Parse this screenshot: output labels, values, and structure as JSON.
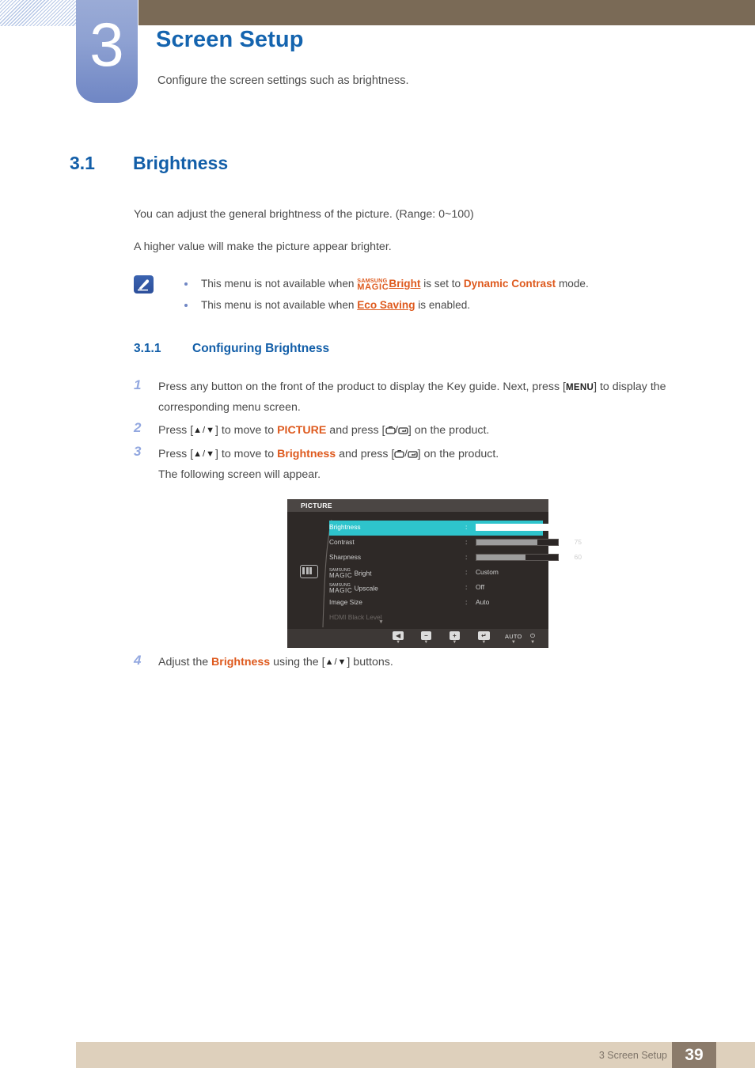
{
  "banner": {
    "chapter_number": "3",
    "title": "Screen Setup",
    "subtitle": "Configure the screen settings such as brightness."
  },
  "section": {
    "number": "3.1",
    "title": "Brightness",
    "paragraph_1": "You can adjust the general brightness of the picture. (Range: 0~100)",
    "paragraph_2": "A higher value will make the picture appear brighter."
  },
  "note": {
    "icon": "note-pen-icon",
    "bullets": [
      {
        "pre": "This menu is not available when ",
        "magic_top": "SAMSUNG",
        "magic_bottom": "MAGIC",
        "magic_suffix": "Bright",
        "mid": " is set to ",
        "emphasis": "Dynamic Contrast",
        "post": " mode."
      },
      {
        "pre": "This menu is not available when ",
        "emphasis_underline": "Eco Saving",
        "post": " is enabled."
      }
    ]
  },
  "subsection": {
    "number": "3.1.1",
    "title": "Configuring Brightness"
  },
  "steps": [
    {
      "number": "1",
      "text_a": "Press any button on the front of the product to display the Key guide. Next, press [",
      "key": "MENU",
      "text_b": "] to display the corresponding menu screen."
    },
    {
      "number": "2",
      "text_a": "Press [",
      "arrows": "▲/▼",
      "text_b": "] to move to ",
      "target": "PICTURE",
      "text_c": " and press [",
      "text_d": "] on the product."
    },
    {
      "number": "3",
      "text_a": "Press [",
      "arrows": "▲/▼",
      "text_b": "] to move to ",
      "target": "Brightness",
      "text_c": " and press [",
      "text_d": "] on the product.",
      "follow_up": "The following screen will appear."
    },
    {
      "number": "4",
      "text_a": "Adjust the ",
      "target": "Brightness",
      "text_b": " using the [",
      "arrows": "▲/▼",
      "text_c": "] buttons."
    }
  ],
  "osd": {
    "title": "PICTURE",
    "sidebar_icon": "picture-mode-icon",
    "rows": [
      {
        "label": "Brightness",
        "colon": ":",
        "value": "100",
        "bar_percent": 100,
        "highlighted": true,
        "type": "slider"
      },
      {
        "label": "Contrast",
        "colon": ":",
        "value": "75",
        "bar_percent": 75,
        "highlighted": false,
        "type": "slider"
      },
      {
        "label": "Sharpness",
        "colon": ":",
        "value": "60",
        "bar_percent": 60,
        "highlighted": false,
        "type": "slider"
      },
      {
        "label_magic_top": "SAMSUNG",
        "label_magic_bottom": "MAGIC",
        "label": "Bright",
        "colon": ":",
        "value": "Custom",
        "type": "value"
      },
      {
        "label_magic_top": "SAMSUNG",
        "label_magic_bottom": "MAGIC",
        "label": "Upscale",
        "colon": ":",
        "value": "Off",
        "type": "value"
      },
      {
        "label": "Image Size",
        "colon": ":",
        "value": "Auto",
        "type": "value"
      },
      {
        "label": "HDMI Black Level",
        "colon": "",
        "value": "",
        "type": "dim"
      }
    ],
    "scroll_indicator": "▼",
    "buttons": [
      {
        "name": "back-button",
        "glyph": "◀",
        "kind": "cap",
        "tri": "▼"
      },
      {
        "name": "minus-button",
        "glyph": "−",
        "kind": "cap",
        "tri": "▼"
      },
      {
        "name": "plus-button",
        "glyph": "+",
        "kind": "cap",
        "tri": "▼"
      },
      {
        "name": "enter-button",
        "glyph": "↵",
        "kind": "cap",
        "tri": "▼"
      },
      {
        "name": "auto-button",
        "glyph": "AUTO",
        "kind": "text",
        "tri": "▼"
      },
      {
        "name": "power-button",
        "glyph": "⏻",
        "kind": "text",
        "tri": "▼"
      }
    ]
  },
  "footer": {
    "text": "3 Screen Setup",
    "page": "39"
  },
  "colors": {
    "heading_blue": "#125ea8",
    "banner_brown": "#7a6a56",
    "chapter_blue": "#8ea1d2",
    "accent_orange": "#de5a1e",
    "osd_highlight": "#2ec4cc",
    "footer_tan": "#ded0bc",
    "footer_page_brown": "#8b7b6b"
  }
}
